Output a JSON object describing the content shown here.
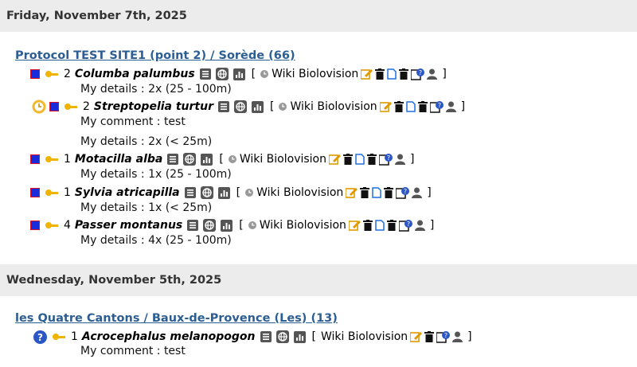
{
  "days": [
    {
      "date": "Friday, November 7th, 2025",
      "site": "Protocol TEST SITE1 (point 2) / Sorède (66)",
      "observations": [
        {
          "count": "2",
          "species": "Columba palumbus",
          "details": "My details : 2x (25 - 100m)",
          "comment": ""
        },
        {
          "count": "2",
          "species": "Streptopelia turtur",
          "details": "My details : 2x (< 25m)",
          "comment": "My comment : test"
        },
        {
          "count": "1",
          "species": "Motacilla alba",
          "details": "My details : 1x (25 - 100m)",
          "comment": ""
        },
        {
          "count": "1",
          "species": "Sylvia atricapilla",
          "details": "My details : 1x (< 25m)",
          "comment": ""
        },
        {
          "count": "4",
          "species": "Passer montanus",
          "details": "My details : 4x (25 - 100m)",
          "comment": ""
        }
      ]
    },
    {
      "date": "Wednesday, November 5th, 2025",
      "site": "les Quatre Cantons / Baux-de-Provence (Les) (13)",
      "observations": [
        {
          "count": "1",
          "species": "Acrocephalus melanopogon",
          "details": "",
          "comment": "My comment : test"
        }
      ]
    }
  ],
  "labels": {
    "wiki": "Wiki Biolovision",
    "open_bracket": "[",
    "close_bracket": "]"
  },
  "colors": {
    "link": "#2c5d93",
    "header_bg": "#ececec",
    "edit": "#f0a500",
    "delete": "#111111",
    "doc": "#1e6fe0",
    "help_badge": "#2a56c6"
  }
}
